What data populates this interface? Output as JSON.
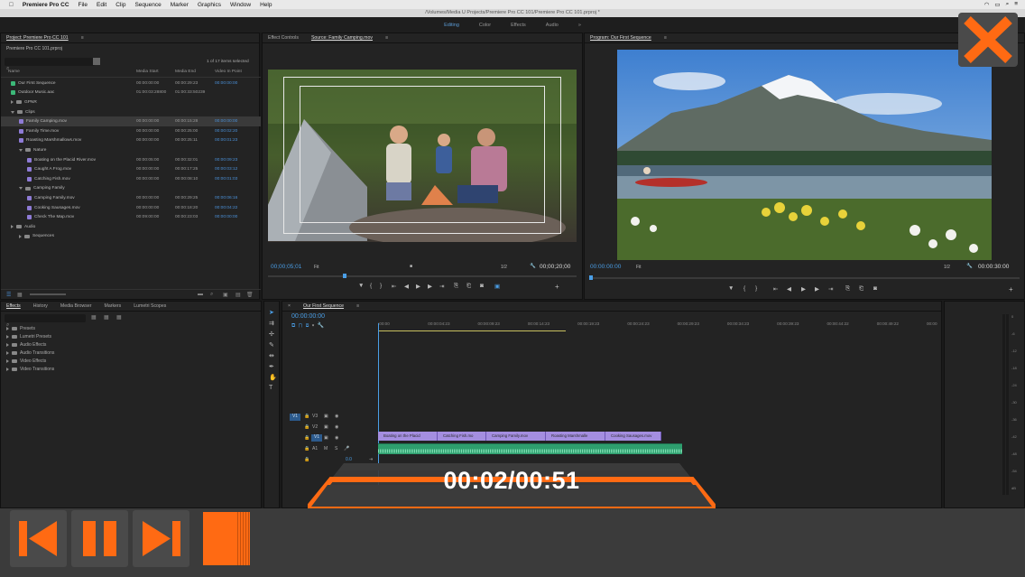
{
  "menubar": {
    "app_name": "Premiere Pro CC",
    "menus": [
      "File",
      "Edit",
      "Clip",
      "Sequence",
      "Marker",
      "Graphics",
      "Window",
      "Help"
    ]
  },
  "title_path": "/Volumes/Media U     Projects/Premiere Pro CC 101/Premiere Pro CC 101.prproj *",
  "workspaces": {
    "items": [
      "Editing",
      "Color",
      "Effects",
      "Audio"
    ],
    "active": "Editing",
    "more": "»"
  },
  "project": {
    "tab": "Project: Premiere Pro CC 101",
    "file": "Premiere Pro CC 101.prproj",
    "count": "1 of 17 items selected",
    "columns": [
      "Name",
      "Media Start",
      "Media End",
      "Video In Point"
    ],
    "rows": [
      {
        "name": "Our First Sequence",
        "start": "00:00:00:00",
        "end": "00:00:29:23",
        "in": "00:00:00:00",
        "color": "#3cb878",
        "indent": 1
      },
      {
        "name": "Outdoor Music.aac",
        "start": "01:00:03:28800",
        "end": "01:00:33:50239",
        "in": "",
        "color": "#3cb878",
        "indent": 1
      },
      {
        "name": "GPNR",
        "start": "",
        "end": "",
        "in": "",
        "color": "#888",
        "indent": 1,
        "folder": true,
        "open": false
      },
      {
        "name": "Clips",
        "start": "",
        "end": "",
        "in": "",
        "color": "#888",
        "indent": 1,
        "folder": true,
        "open": true
      },
      {
        "name": "Family Camping.mov",
        "start": "00:00:00:00",
        "end": "00:00:15:28",
        "in": "00:00:00:00",
        "color": "#8e7bd6",
        "indent": 2,
        "selected": true
      },
      {
        "name": "Family Time.mov",
        "start": "00:00:00:00",
        "end": "00:00:25:00",
        "in": "00:00:02:20",
        "color": "#8e7bd6",
        "indent": 2
      },
      {
        "name": "Roasting Marshmallows.mov",
        "start": "00:00:00:00",
        "end": "00:00:25:11",
        "in": "00:00:01:23",
        "color": "#8e7bd6",
        "indent": 2
      },
      {
        "name": "Nature",
        "start": "",
        "end": "",
        "in": "",
        "color": "#888",
        "indent": 2,
        "folder": true,
        "open": true
      },
      {
        "name": "Boating on the Placid River.mov",
        "start": "00:00:05:00",
        "end": "00:00:32:01",
        "in": "00:00:09:23",
        "color": "#8e7bd6",
        "indent": 3
      },
      {
        "name": "Caught A Frog.mov",
        "start": "00:00:00:00",
        "end": "00:00:17:25",
        "in": "00:00:03:12",
        "color": "#8e7bd6",
        "indent": 3
      },
      {
        "name": "Catching Fish.mov",
        "start": "00:00:00:00",
        "end": "00:00:08:10",
        "in": "00:00:01:03",
        "color": "#8e7bd6",
        "indent": 3
      },
      {
        "name": "Camping Family",
        "start": "",
        "end": "",
        "in": "",
        "color": "#888",
        "indent": 2,
        "folder": true,
        "open": true
      },
      {
        "name": "Camping Family.mov",
        "start": "00:00:00:00",
        "end": "00:00:29:25",
        "in": "00:00:06:16",
        "color": "#8e7bd6",
        "indent": 3
      },
      {
        "name": "Cooking Sausages.mov",
        "start": "00:00:00:00",
        "end": "00:00:18:20",
        "in": "00:00:04:22",
        "color": "#8e7bd6",
        "indent": 3
      },
      {
        "name": "Check The Map.mov",
        "start": "00:09:00:00",
        "end": "00:00:23:03",
        "in": "00:00:00:00",
        "color": "#8e7bd6",
        "indent": 3
      },
      {
        "name": "Audio",
        "start": "",
        "end": "",
        "in": "",
        "color": "#888",
        "indent": 1,
        "folder": true,
        "open": false
      },
      {
        "name": "Sequences",
        "start": "",
        "end": "",
        "in": "",
        "color": "#888",
        "indent": 2,
        "folder": true,
        "open": false
      }
    ]
  },
  "source": {
    "tabs": [
      "Effect Controls",
      "Source: Family Camping.mov"
    ],
    "timecode": "00;00;05;01",
    "fit": "Fit",
    "ratio": "1/2",
    "duration": "00;00;20;00"
  },
  "program": {
    "tab": "Program: Our First Sequence",
    "timecode": "00:00:00:00",
    "fit": "Fit",
    "ratio": "1/2",
    "duration": "00:00:30:00"
  },
  "effects": {
    "tabs": [
      "Effects",
      "History",
      "Media Browser",
      "Markers",
      "Lumetri Scopes"
    ],
    "items": [
      "Presets",
      "Lumetri Presets",
      "Audio Effects",
      "Audio Transitions",
      "Video Effects",
      "Video Transitions"
    ]
  },
  "timeline": {
    "tab": "Our First Sequence",
    "timecode": "00:00:00:00",
    "ruler": [
      ":00:00",
      "00:00:04:23",
      "00:00:09:23",
      "00:00:14:23",
      "00:00:19:23",
      "00:00:24:23",
      "00:00:29:23",
      "00:00:34:23",
      "00:00:39:23",
      "00:00:44:22",
      "00:00:49:22",
      "00:00"
    ],
    "tracks": [
      "V3",
      "V2",
      "V1",
      "A1",
      "A2"
    ],
    "master_level": "0.0",
    "clips": [
      "Boating on the Placid",
      "Catching Fish.mo",
      "Camping Family.mov",
      "Roasting Marshmalle",
      "Cooking Sausages.mov"
    ]
  },
  "meters": {
    "scale": [
      "0",
      "-6",
      "-12",
      "-18",
      "-24",
      "-30",
      "-36",
      "-42",
      "-48",
      "-54",
      "dB"
    ]
  },
  "player": {
    "time": "00:02/00:51",
    "progress": 0.04,
    "accent": "#ff6a13"
  }
}
